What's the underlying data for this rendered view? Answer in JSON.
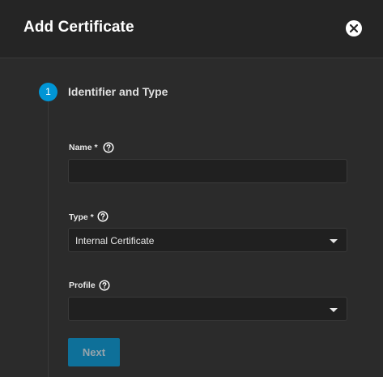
{
  "dialog": {
    "title": "Add Certificate",
    "close_icon": "close-icon"
  },
  "stepper": {
    "step_number": "1",
    "step_label": "Identifier and Type"
  },
  "fields": {
    "name": {
      "label": "Name",
      "required_marker": "*",
      "value": "",
      "help_icon": "help-icon"
    },
    "type": {
      "label": "Type",
      "required_marker": "*",
      "value": "Internal Certificate",
      "help_icon": "help-icon"
    },
    "profile": {
      "label": "Profile",
      "value": "",
      "help_icon": "help-icon"
    }
  },
  "actions": {
    "next_label": "Next"
  },
  "colors": {
    "accent": "#0095d5",
    "background": "#2b2b2b",
    "header": "#252525",
    "input_bg": "#202020"
  }
}
